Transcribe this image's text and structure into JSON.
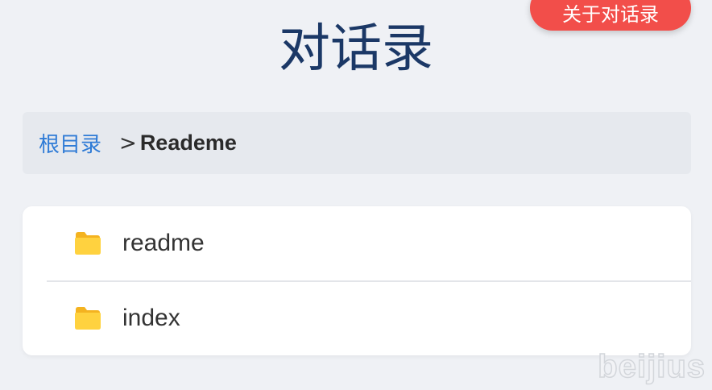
{
  "header": {
    "about_button": "关于对话录",
    "title": "对话录"
  },
  "breadcrumb": {
    "root": "根目录",
    "separator": ">",
    "current": "Reademe"
  },
  "files": [
    {
      "name": "readme",
      "icon": "folder-icon"
    },
    {
      "name": "index",
      "icon": "folder-icon"
    }
  ],
  "watermark": "beijius",
  "colors": {
    "accent_red": "#f24e4a",
    "title": "#1b3866",
    "link": "#2f7bd6",
    "folder": "#ffcb3d"
  }
}
